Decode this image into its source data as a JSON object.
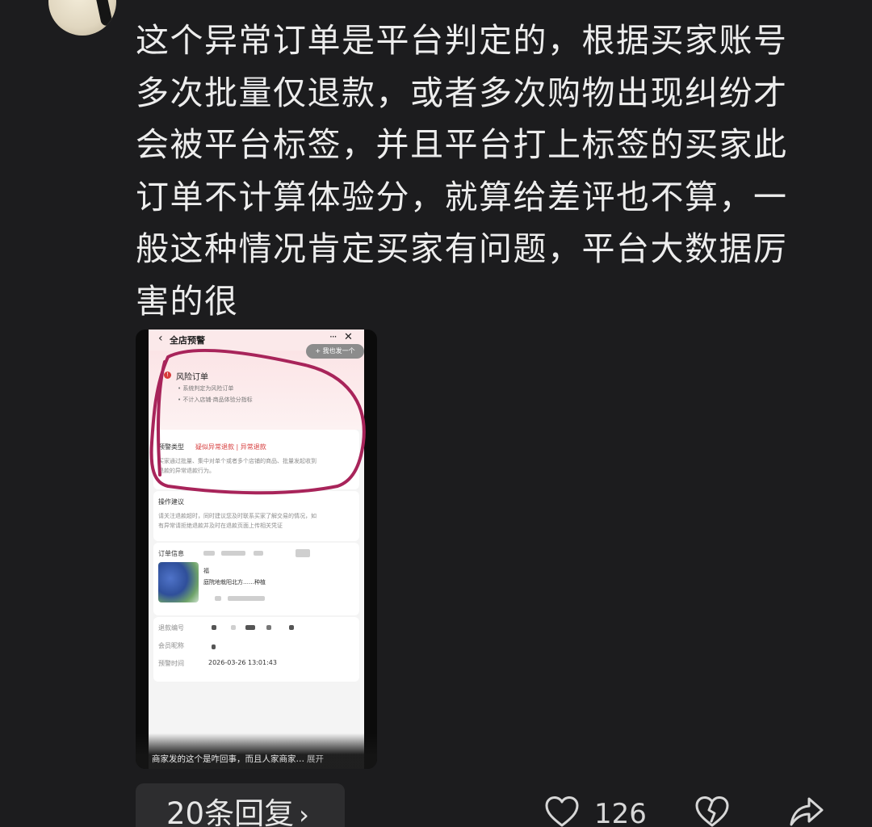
{
  "comment": {
    "text": "这个异常订单是平台判定的，根据买家账号多次批量仅退款，或者多次购物出现纠纷才会被平台标签，并且平台打上标签的买家此订单不计算体验分，就算给差评也不算，一般这种情况肯定买家有问题，平台大数据厉害的很"
  },
  "screenshot": {
    "title": "全店预警",
    "more_label": "···",
    "close_label": "✕",
    "pill_label": "+ 我也发一个",
    "risk_title": "风险订单",
    "risk_bullet_1": "• 系统判定为风险订单",
    "risk_bullet_2": "• 不计入店铺·商品体验分指标",
    "warning_type_label": "预警类型",
    "warning_type_value": "疑似异常退款 | 异常退款",
    "warning_desc_1": "买家通过批量、集中对单个或者多个店铺的商品、批量发起收到",
    "warning_desc_2": "退款的异常退款行为。",
    "advice_label": "操作建议",
    "advice_1": "请关注退款超时，同时建议您及时联系买家了解交易的情况，如",
    "advice_2": "有异常请拒绝退款并及时在退款页面上传相关凭证",
    "order_info_label": "订单信息",
    "product_line_1": "福",
    "product_line_2": "庭院地栽阳北方……种植",
    "refund_no_label": "退款编号",
    "member_label": "会员昵称",
    "warn_time_label": "预警时间",
    "warn_time_value": "2026-03-26 13:01:43",
    "caption": "商家发的这个是咋回事，而且人家商家…",
    "caption_expand": "展开"
  },
  "footer": {
    "reply_label": "20条回复",
    "reply_chevron": "›",
    "like_count": "126"
  },
  "icons": {
    "like": "heart-outline-icon",
    "dislike": "broken-heart-icon",
    "share": "share-arrow-icon"
  },
  "colors": {
    "background": "#1c1c1e",
    "text": "#ececec",
    "ink_annotation": "#a8245a",
    "reply_button": "#2d2d2f"
  }
}
